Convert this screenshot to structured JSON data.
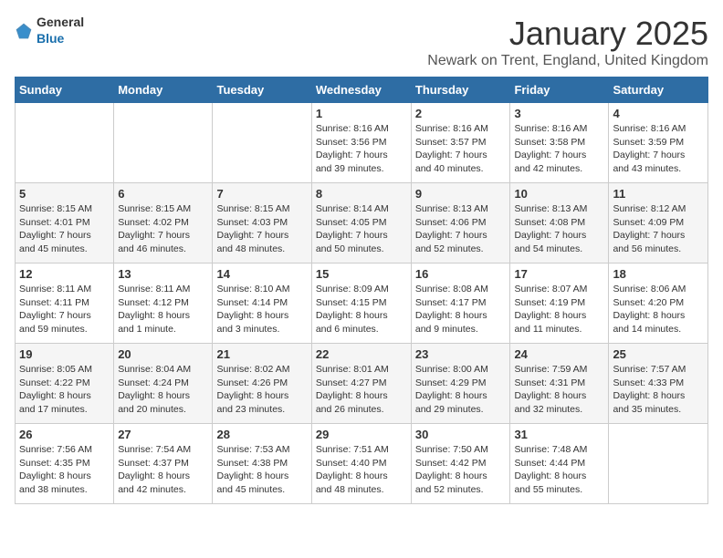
{
  "header": {
    "logo_general": "General",
    "logo_blue": "Blue",
    "title": "January 2025",
    "subtitle": "Newark on Trent, England, United Kingdom"
  },
  "days_of_week": [
    "Sunday",
    "Monday",
    "Tuesday",
    "Wednesday",
    "Thursday",
    "Friday",
    "Saturday"
  ],
  "weeks": [
    [
      {
        "day": "",
        "info": ""
      },
      {
        "day": "",
        "info": ""
      },
      {
        "day": "",
        "info": ""
      },
      {
        "day": "1",
        "info": "Sunrise: 8:16 AM\nSunset: 3:56 PM\nDaylight: 7 hours\nand 39 minutes."
      },
      {
        "day": "2",
        "info": "Sunrise: 8:16 AM\nSunset: 3:57 PM\nDaylight: 7 hours\nand 40 minutes."
      },
      {
        "day": "3",
        "info": "Sunrise: 8:16 AM\nSunset: 3:58 PM\nDaylight: 7 hours\nand 42 minutes."
      },
      {
        "day": "4",
        "info": "Sunrise: 8:16 AM\nSunset: 3:59 PM\nDaylight: 7 hours\nand 43 minutes."
      }
    ],
    [
      {
        "day": "5",
        "info": "Sunrise: 8:15 AM\nSunset: 4:01 PM\nDaylight: 7 hours\nand 45 minutes."
      },
      {
        "day": "6",
        "info": "Sunrise: 8:15 AM\nSunset: 4:02 PM\nDaylight: 7 hours\nand 46 minutes."
      },
      {
        "day": "7",
        "info": "Sunrise: 8:15 AM\nSunset: 4:03 PM\nDaylight: 7 hours\nand 48 minutes."
      },
      {
        "day": "8",
        "info": "Sunrise: 8:14 AM\nSunset: 4:05 PM\nDaylight: 7 hours\nand 50 minutes."
      },
      {
        "day": "9",
        "info": "Sunrise: 8:13 AM\nSunset: 4:06 PM\nDaylight: 7 hours\nand 52 minutes."
      },
      {
        "day": "10",
        "info": "Sunrise: 8:13 AM\nSunset: 4:08 PM\nDaylight: 7 hours\nand 54 minutes."
      },
      {
        "day": "11",
        "info": "Sunrise: 8:12 AM\nSunset: 4:09 PM\nDaylight: 7 hours\nand 56 minutes."
      }
    ],
    [
      {
        "day": "12",
        "info": "Sunrise: 8:11 AM\nSunset: 4:11 PM\nDaylight: 7 hours\nand 59 minutes."
      },
      {
        "day": "13",
        "info": "Sunrise: 8:11 AM\nSunset: 4:12 PM\nDaylight: 8 hours\nand 1 minute."
      },
      {
        "day": "14",
        "info": "Sunrise: 8:10 AM\nSunset: 4:14 PM\nDaylight: 8 hours\nand 3 minutes."
      },
      {
        "day": "15",
        "info": "Sunrise: 8:09 AM\nSunset: 4:15 PM\nDaylight: 8 hours\nand 6 minutes."
      },
      {
        "day": "16",
        "info": "Sunrise: 8:08 AM\nSunset: 4:17 PM\nDaylight: 8 hours\nand 9 minutes."
      },
      {
        "day": "17",
        "info": "Sunrise: 8:07 AM\nSunset: 4:19 PM\nDaylight: 8 hours\nand 11 minutes."
      },
      {
        "day": "18",
        "info": "Sunrise: 8:06 AM\nSunset: 4:20 PM\nDaylight: 8 hours\nand 14 minutes."
      }
    ],
    [
      {
        "day": "19",
        "info": "Sunrise: 8:05 AM\nSunset: 4:22 PM\nDaylight: 8 hours\nand 17 minutes."
      },
      {
        "day": "20",
        "info": "Sunrise: 8:04 AM\nSunset: 4:24 PM\nDaylight: 8 hours\nand 20 minutes."
      },
      {
        "day": "21",
        "info": "Sunrise: 8:02 AM\nSunset: 4:26 PM\nDaylight: 8 hours\nand 23 minutes."
      },
      {
        "day": "22",
        "info": "Sunrise: 8:01 AM\nSunset: 4:27 PM\nDaylight: 8 hours\nand 26 minutes."
      },
      {
        "day": "23",
        "info": "Sunrise: 8:00 AM\nSunset: 4:29 PM\nDaylight: 8 hours\nand 29 minutes."
      },
      {
        "day": "24",
        "info": "Sunrise: 7:59 AM\nSunset: 4:31 PM\nDaylight: 8 hours\nand 32 minutes."
      },
      {
        "day": "25",
        "info": "Sunrise: 7:57 AM\nSunset: 4:33 PM\nDaylight: 8 hours\nand 35 minutes."
      }
    ],
    [
      {
        "day": "26",
        "info": "Sunrise: 7:56 AM\nSunset: 4:35 PM\nDaylight: 8 hours\nand 38 minutes."
      },
      {
        "day": "27",
        "info": "Sunrise: 7:54 AM\nSunset: 4:37 PM\nDaylight: 8 hours\nand 42 minutes."
      },
      {
        "day": "28",
        "info": "Sunrise: 7:53 AM\nSunset: 4:38 PM\nDaylight: 8 hours\nand 45 minutes."
      },
      {
        "day": "29",
        "info": "Sunrise: 7:51 AM\nSunset: 4:40 PM\nDaylight: 8 hours\nand 48 minutes."
      },
      {
        "day": "30",
        "info": "Sunrise: 7:50 AM\nSunset: 4:42 PM\nDaylight: 8 hours\nand 52 minutes."
      },
      {
        "day": "31",
        "info": "Sunrise: 7:48 AM\nSunset: 4:44 PM\nDaylight: 8 hours\nand 55 minutes."
      },
      {
        "day": "",
        "info": ""
      }
    ]
  ]
}
